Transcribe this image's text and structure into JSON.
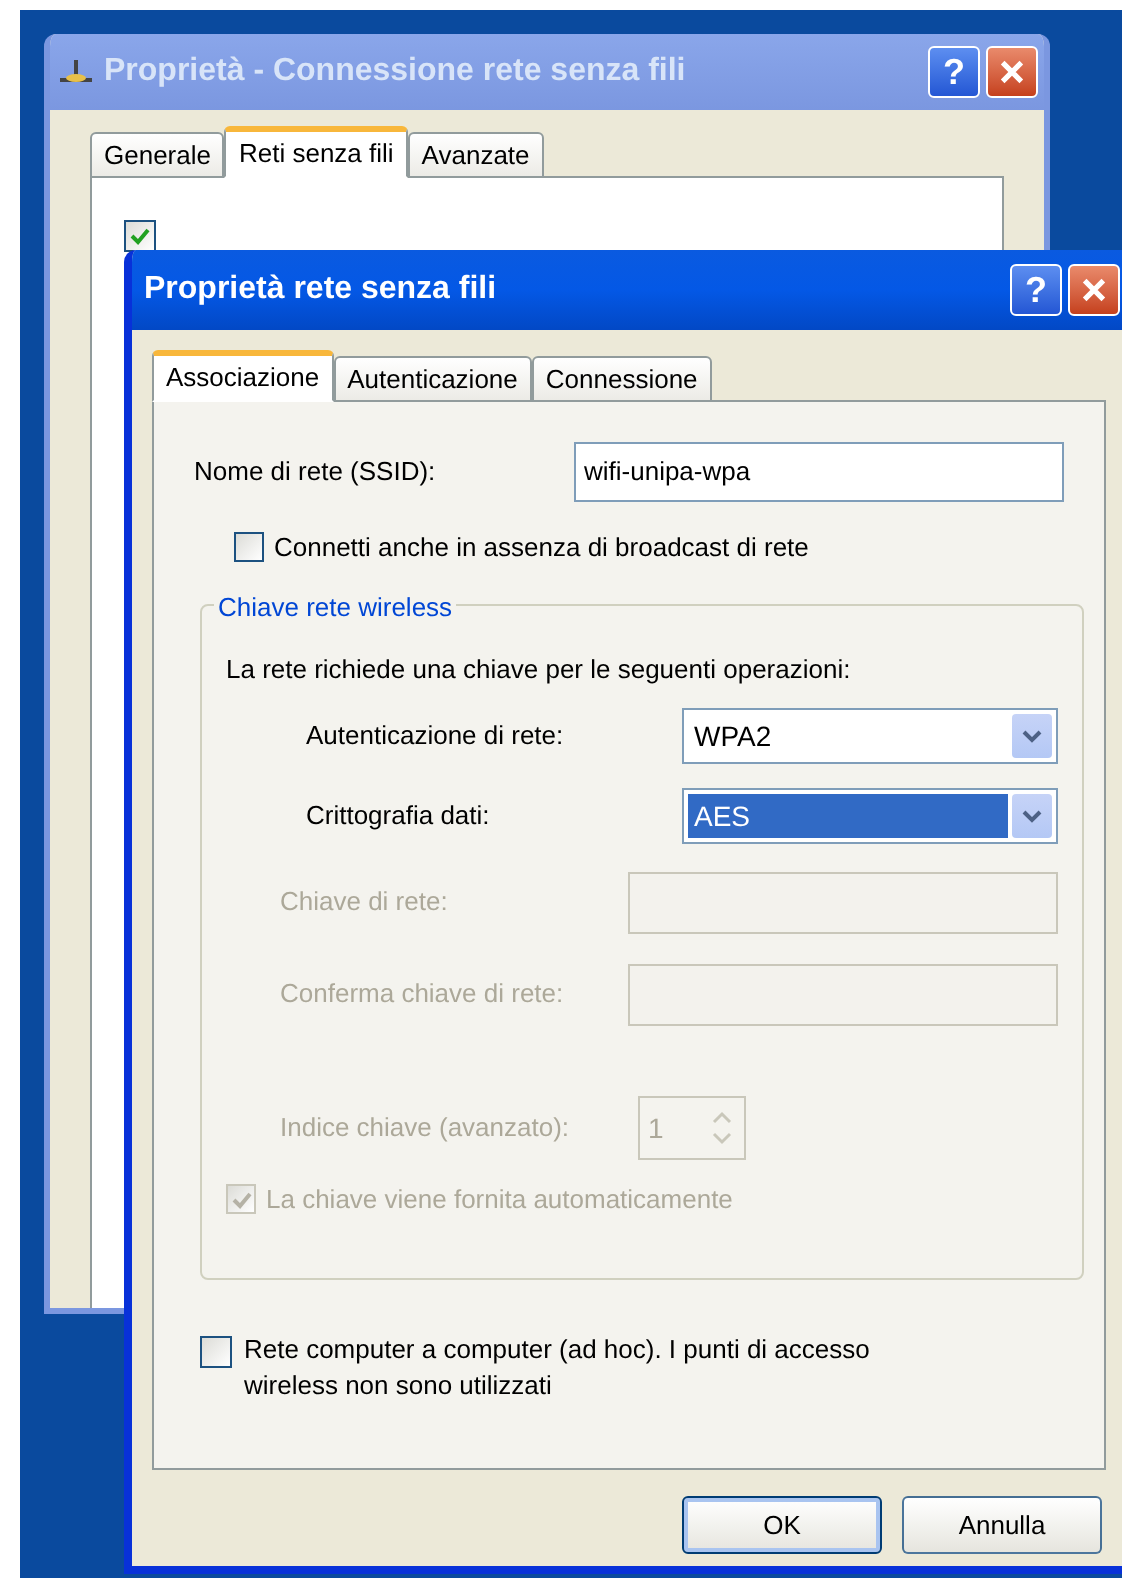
{
  "back_window": {
    "title": "Proprietà - Connessione rete senza fili",
    "active": false,
    "help_button": "?",
    "tabs": [
      {
        "label": "Generale",
        "selected": false
      },
      {
        "label": "Reti senza fili",
        "selected": true
      },
      {
        "label": "Avanzate",
        "selected": false
      }
    ],
    "checkbox": {
      "checked": true
    }
  },
  "front_window": {
    "title": "Proprietà rete senza fili",
    "active": true,
    "help_button": "?",
    "tabs": [
      {
        "label": "Associazione",
        "selected": true
      },
      {
        "label": "Autenticazione",
        "selected": false
      },
      {
        "label": "Connessione",
        "selected": false
      }
    ],
    "ssid": {
      "label": "Nome di rete (SSID):",
      "value": "wifi-unipa-wpa"
    },
    "broadcast": {
      "label": "Connetti anche in assenza di broadcast di rete",
      "checked": false
    },
    "group": {
      "title": "Chiave rete wireless",
      "note": "La rete richiede una chiave per le seguenti operazioni:",
      "rows": [
        {
          "kind": "select",
          "label": "Autenticazione di rete:",
          "value": "WPA2",
          "disabled": false,
          "focused": false
        },
        {
          "kind": "select",
          "label": "Crittografia dati:",
          "value": "AES",
          "disabled": false,
          "focused": true
        },
        {
          "kind": "input",
          "label": "Chiave di rete:",
          "disabled": true
        },
        {
          "kind": "input",
          "label": "Conferma chiave di rete:",
          "disabled": true
        },
        {
          "kind": "spinner",
          "label": "Indice chiave (avanzato):",
          "value": "1",
          "disabled": true
        },
        {
          "kind": "checkbox",
          "label": "La chiave viene fornita automaticamente",
          "checked": true,
          "disabled": true
        }
      ]
    },
    "adhoc": {
      "label": "Rete computer a computer (ad hoc). I punti di accesso wireless non sono utilizzati",
      "checked": false
    },
    "buttons": [
      {
        "label": "OK",
        "default": true
      },
      {
        "label": "Annulla",
        "default": false
      }
    ]
  }
}
